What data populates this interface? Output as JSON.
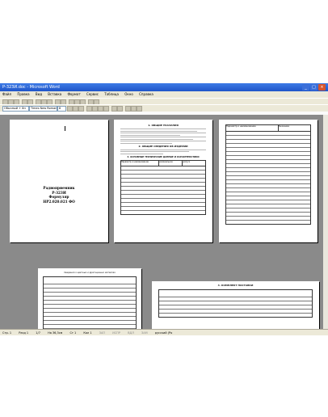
{
  "window": {
    "title": "Р-323И.doc - Microsoft Word",
    "controls": [
      "minimize",
      "maximize",
      "close"
    ]
  },
  "menu": [
    "Файл",
    "Правка",
    "Вид",
    "Вставка",
    "Формат",
    "Сервис",
    "Таблица",
    "Окно",
    "Справка"
  ],
  "toolbar": {
    "style_value": "Обычный + 8п",
    "font_value": "Times New Roman",
    "size_value": "8"
  },
  "pages": {
    "title_page": {
      "name": "Радиоприемник",
      "model": "Р-323И",
      "doc_type": "Формуляр",
      "code": "НР2.020.021 ФО"
    },
    "page2": {
      "section1": "1. ОБЩИЕ УКАЗАНИЯ",
      "section2": "2. ОБЩИЕ СВЕДЕНИЯ ОБ ИЗДЕЛИИ",
      "section3": "3. ОСНОВНЫЕ ТЕХНИЧЕСКИЕ ДАННЫЕ И ХАРАКТЕРИСТИКИ",
      "col1": "Параметр и наименование",
      "col2": "номинальное",
      "col3": "допуск"
    },
    "page3": {
      "col1": "Параметр и наименование",
      "col2": "Значение"
    },
    "page4": {
      "header": "Сведения о цветных и драгоценных металлах"
    },
    "page5": {
      "header": "4. КОМПЛЕКТ ПОСТАВКИ"
    }
  },
  "status": {
    "page": "Стр. 1",
    "section": "Разд 1",
    "pages": "1/7",
    "position": "На 36,3см",
    "line": "Ст 1",
    "column": "Кол 1",
    "modes": [
      "ЗАП",
      "ИСПР",
      "ВДЛ",
      "ЗАМ"
    ],
    "language": "русский (Ро"
  }
}
